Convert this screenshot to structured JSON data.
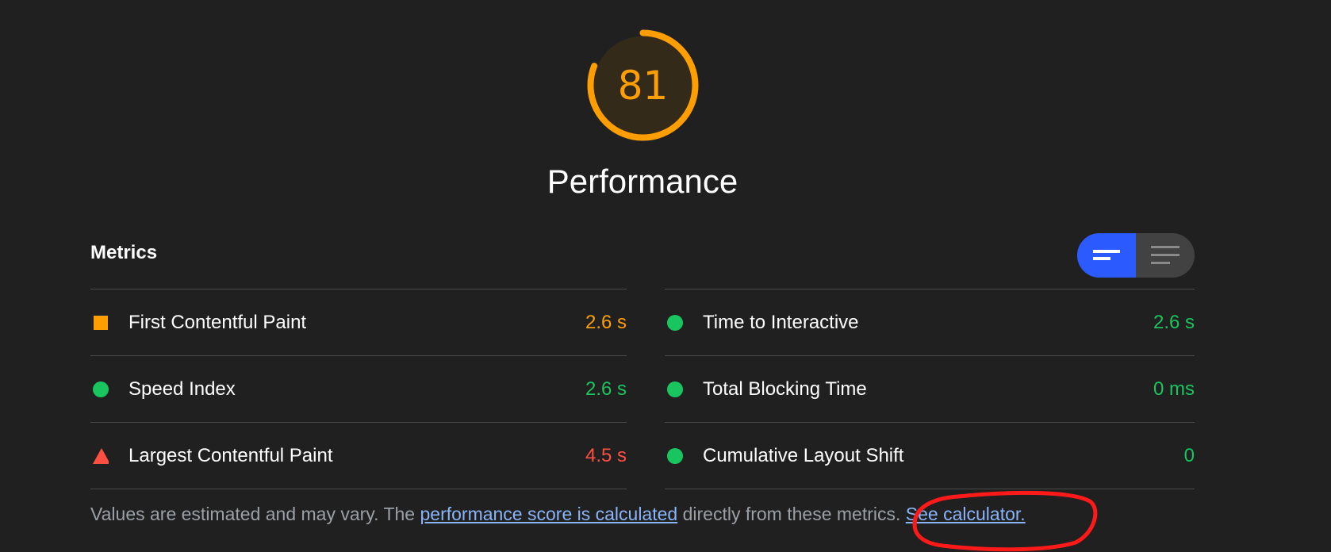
{
  "gauge": {
    "score": "81",
    "score_fraction": 0.81,
    "title": "Performance",
    "color": "#ff9e00"
  },
  "metrics": {
    "header": "Metrics",
    "left": [
      {
        "label": "First Contentful Paint",
        "value": "2.6 s",
        "status": "average",
        "icon": "orange-square-icon"
      },
      {
        "label": "Speed Index",
        "value": "2.6 s",
        "status": "pass",
        "icon": "green-circle-icon"
      },
      {
        "label": "Largest Contentful Paint",
        "value": "4.5 s",
        "status": "fail",
        "icon": "red-triangle-icon"
      }
    ],
    "right": [
      {
        "label": "Time to Interactive",
        "value": "2.6 s",
        "status": "pass",
        "icon": "green-circle-icon"
      },
      {
        "label": "Total Blocking Time",
        "value": "0 ms",
        "status": "pass",
        "icon": "green-circle-icon"
      },
      {
        "label": "Cumulative Layout Shift",
        "value": "0",
        "status": "pass",
        "icon": "green-circle-icon"
      }
    ]
  },
  "view_toggle": {
    "active": "summary",
    "summary_icon": "summary-view-icon",
    "detail_icon": "detail-view-icon"
  },
  "footer": {
    "text_1": "Values are estimated and may vary. The ",
    "link_1": "performance score is calculated",
    "text_2": " directly from these metrics. ",
    "link_2": "See calculator."
  },
  "colors": {
    "average": "#ff9e00",
    "pass": "#19c55e",
    "fail": "#ff4e42",
    "accent": "#2b5bff",
    "link": "#8ab4f8",
    "annotation": "#ff1a1a"
  }
}
